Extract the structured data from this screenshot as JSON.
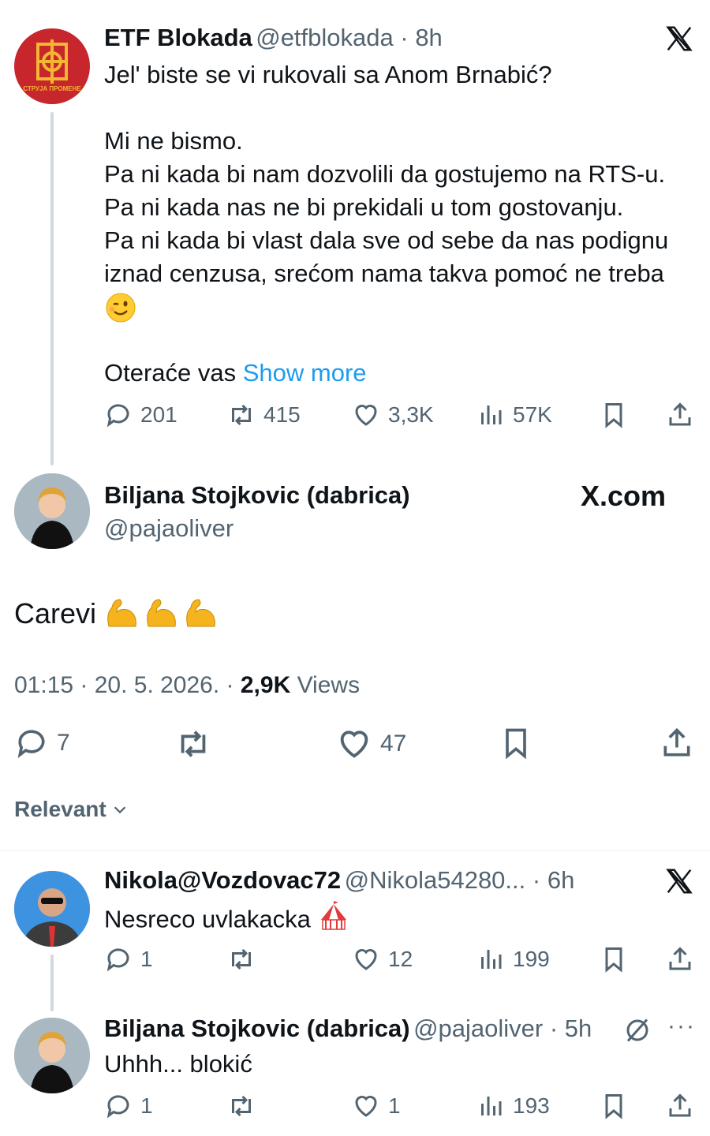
{
  "tweet1": {
    "name": "ETF Blokada",
    "handle": "@etfblokada",
    "time": "8h",
    "avatar_caption": "СТРУЈА ПРОМЕНЕ",
    "lines": [
      "Jel' biste se vi rukovali sa Anom Brnabić?",
      "",
      "Mi ne bismo.",
      "Pa ni kada bi nam dozvolili da gostujemo na RTS-u.",
      "Pa ni kada nas ne bi prekidali u tom gostovanju.",
      "Pa ni kada bi vlast dala sve od sebe da nas podignu",
      "iznad cenzusa, srećom nama takva pomoć ne treba"
    ],
    "emoji_icon": "winking-face",
    "last_line": "Oteraće vas",
    "show_more": "Show more",
    "stats": {
      "replies": "201",
      "reposts": "415",
      "likes": "3,3K",
      "views": "57K"
    }
  },
  "main": {
    "name": "Biljana Stojkovic (dabrica)",
    "handle": "@pajaoliver",
    "brand": "X.com",
    "text": "Carevi",
    "emoji_icon": "flexed-biceps",
    "timestamp": "01:15 · 20. 5. 2026. · ",
    "views_count": "2,9K",
    "views_label": " Views",
    "stats": {
      "replies": "7",
      "likes": "47"
    }
  },
  "sort": {
    "label": "Relevant"
  },
  "reply1": {
    "name": "Nikola@Vozdovac72",
    "handle": "@Nikola54280...",
    "time": "6h",
    "text": "Nesreco uvlakacka",
    "emoji_icon": "circus-tent",
    "stats": {
      "replies": "1",
      "likes": "12",
      "views": "199"
    }
  },
  "reply2": {
    "name": "Biljana Stojkovic (dabrica)",
    "handle": "@pajaoliver",
    "time": "5h",
    "text": "Uhhh... blokić",
    "stats": {
      "replies": "1",
      "likes": "1",
      "views": "193"
    }
  },
  "colors": {
    "link": "#1d9bf0",
    "muted": "#536471",
    "etf_red": "#c8262d",
    "etf_gold": "#f2b632"
  }
}
